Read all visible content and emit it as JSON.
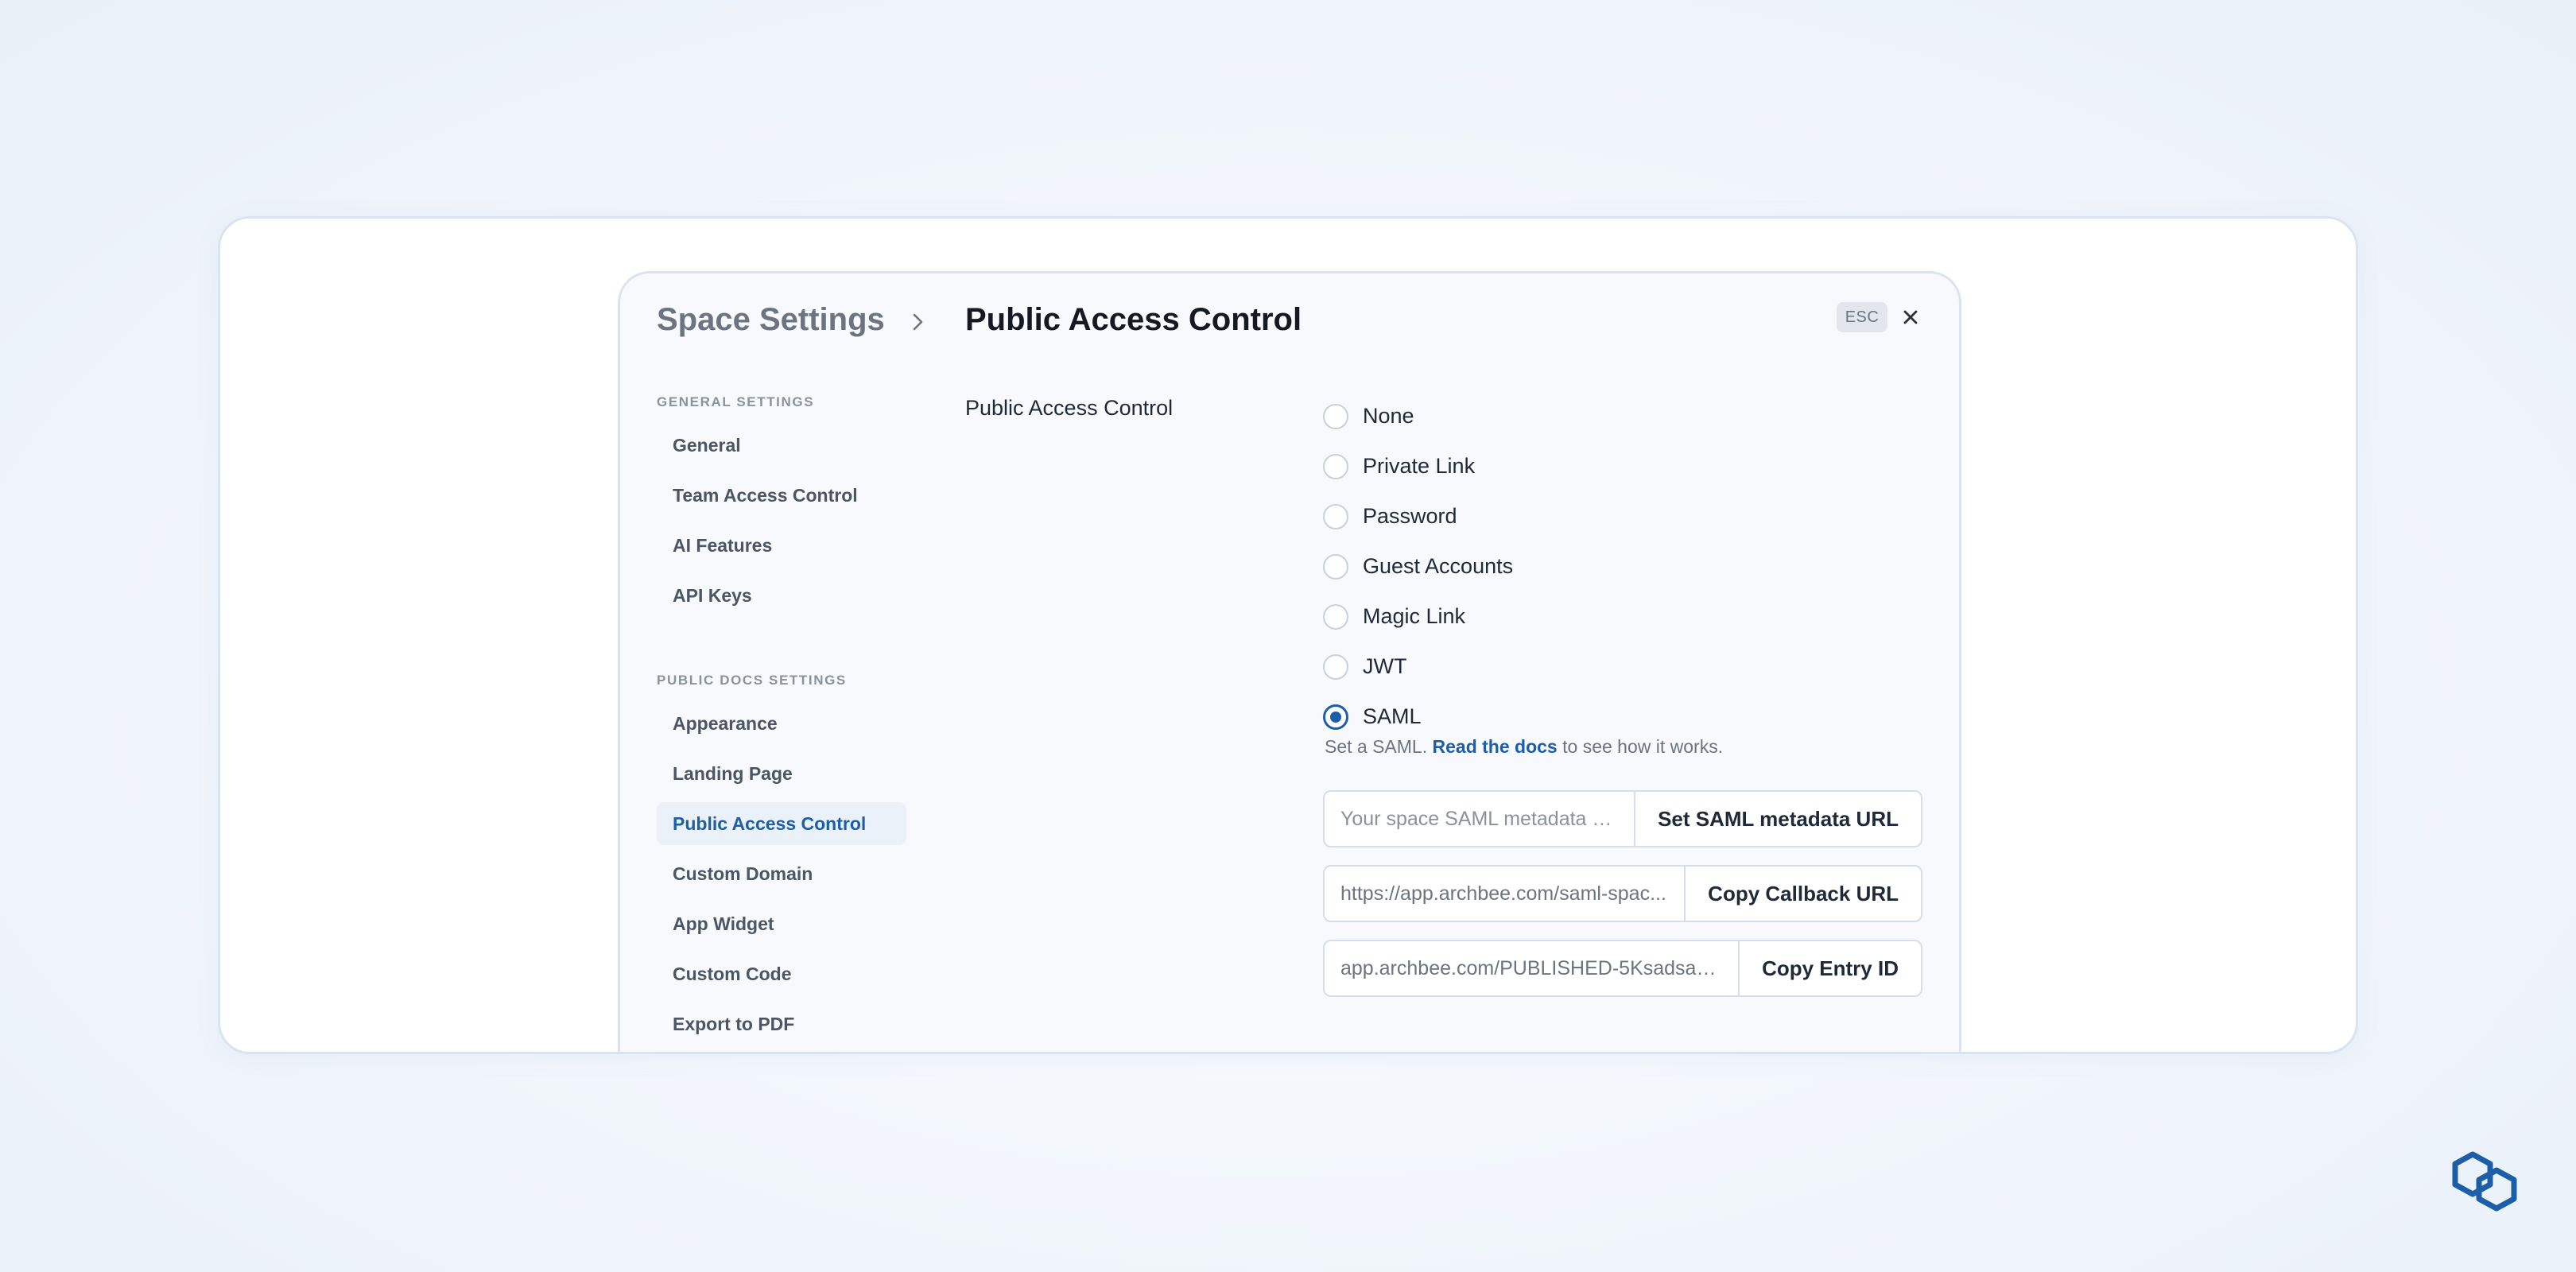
{
  "header": {
    "parent": "Space Settings",
    "current": "Public Access Control",
    "esc_label": "ESC"
  },
  "sidebar": {
    "general_section": "GENERAL SETTINGS",
    "general_items": [
      {
        "label": "General"
      },
      {
        "label": "Team Access Control"
      },
      {
        "label": "AI Features"
      },
      {
        "label": "API Keys"
      }
    ],
    "public_section": "PUBLIC DOCS SETTINGS",
    "public_items": [
      {
        "label": "Appearance"
      },
      {
        "label": "Landing Page"
      },
      {
        "label": "Public Access Control",
        "active": true
      },
      {
        "label": "Custom Domain"
      },
      {
        "label": "App Widget"
      },
      {
        "label": "Custom Code"
      },
      {
        "label": "Export to PDF"
      }
    ]
  },
  "main": {
    "field_label": "Public Access Control",
    "options": [
      {
        "label": "None",
        "selected": false
      },
      {
        "label": "Private Link",
        "selected": false
      },
      {
        "label": "Password",
        "selected": false
      },
      {
        "label": "Guest Accounts",
        "selected": false
      },
      {
        "label": "Magic Link",
        "selected": false
      },
      {
        "label": "JWT",
        "selected": false
      },
      {
        "label": "SAML",
        "selected": true
      }
    ],
    "hint_prefix": "Set a SAML.",
    "hint_link": "Read the docs",
    "hint_suffix": "to see how it works.",
    "saml_metadata": {
      "placeholder": "Your space SAML metadata U...",
      "value": "",
      "button": "Set SAML metadata URL"
    },
    "callback": {
      "value": "https://app.archbee.com/saml-spac...",
      "button": "Copy Callback URL"
    },
    "entry_id": {
      "value": "app.archbee.com/PUBLISHED-5KsadsaM...",
      "button": "Copy Entry ID"
    }
  },
  "colors": {
    "accent": "#1d5ea8",
    "active_bg": "#eaf1f9",
    "text": "#1f2937",
    "muted": "#6b7480"
  },
  "icons": {
    "breadcrumb_separator": "chevron-right-icon",
    "close": "close-icon",
    "brand": "archbee-logo-icon"
  }
}
